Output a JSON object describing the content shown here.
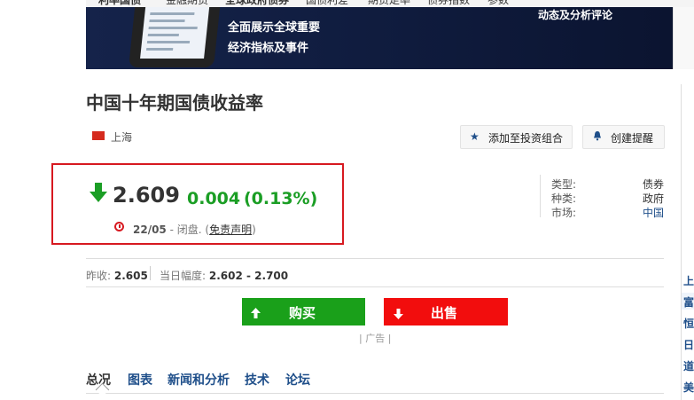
{
  "nav": {
    "items": [
      "利率国债",
      "金融期货",
      "全球政府债券",
      "国债利差",
      "期货走率",
      "债券指数",
      "参数"
    ]
  },
  "banner": {
    "line1": "全面展示全球重要",
    "line2": "经济指标及事件",
    "right_text": "动态及分析评论"
  },
  "instrument": {
    "title": "中国十年期国债收益率",
    "exchange": "上海"
  },
  "actions": {
    "add_portfolio": "添加至投资组合",
    "create_alert": "创建提醒"
  },
  "quote": {
    "price": "2.609",
    "change": "0.004",
    "change_pct": "(0.13%)",
    "direction": "down",
    "date": "22/05",
    "status_text": "- 闭盘. (",
    "disclaimer": "免责声明",
    "status_close": ")"
  },
  "info": {
    "type_label": "类型:",
    "type_value": "债券",
    "kind_label": "种类:",
    "kind_value": "政府",
    "market_label": "市场:",
    "market_value": "中国"
  },
  "stats": {
    "prev_close_label": "昨收:",
    "prev_close": "2.605",
    "range_label": "当日幅度:",
    "range": "2.602 - 2.700"
  },
  "trade": {
    "buy": "购买",
    "sell": "出售",
    "ad": "| 广告 |"
  },
  "tabs": [
    "总况",
    "图表",
    "新闻和分析",
    "技术",
    "论坛"
  ],
  "sidebar": {
    "items": [
      "上",
      "富",
      "恒",
      "日",
      "道",
      "美"
    ]
  },
  "colors": {
    "down": "#1b9e25",
    "highlight_border": "#d71920",
    "buy": "#1aa01a",
    "sell": "#f20d0d",
    "link": "#1f4f8a"
  }
}
